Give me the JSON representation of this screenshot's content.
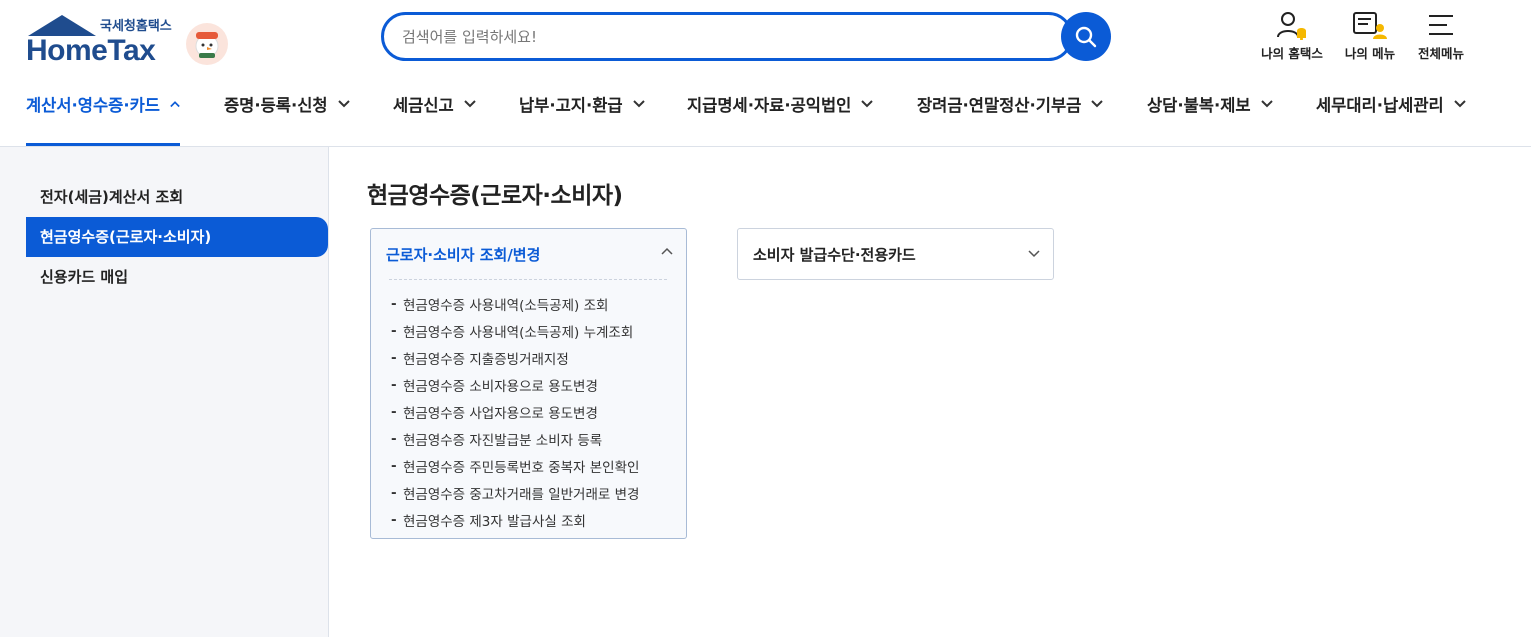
{
  "header": {
    "logo_main": "HomeTax",
    "logo_sub": "국세청홈택스",
    "search_placeholder": "검색어를 입력하세요!",
    "util": [
      {
        "label": "나의 홈택스",
        "icon": "user-bell-icon"
      },
      {
        "label": "나의 메뉴",
        "icon": "menu-user-icon"
      },
      {
        "label": "전체메뉴",
        "icon": "hamburger-icon"
      }
    ]
  },
  "gnb": [
    {
      "label": "계산서·영수증·카드",
      "active": true
    },
    {
      "label": "증명·등록·신청"
    },
    {
      "label": "세금신고"
    },
    {
      "label": "납부·고지·환급"
    },
    {
      "label": "지급명세·자료·공익법인"
    },
    {
      "label": "장려금·연말정산·기부금"
    },
    {
      "label": "상담·불복·제보"
    },
    {
      "label": "세무대리·납세관리"
    }
  ],
  "lnb": [
    {
      "label": "전자(세금)계산서 조회"
    },
    {
      "label": "현금영수증(근로자·소비자)",
      "active": true
    },
    {
      "label": "신용카드 매입"
    }
  ],
  "main": {
    "title": "현금영수증(근로자·소비자)",
    "card": {
      "heading": "근로자·소비자 조회/변경",
      "items": [
        "현금영수증 사용내역(소득공제) 조회",
        "현금영수증 사용내역(소득공제) 누계조회",
        "현금영수증 지출증빙거래지정",
        "현금영수증 소비자용으로 용도변경",
        "현금영수증 사업자용으로 용도변경",
        "현금영수증 자진발급분 소비자 등록",
        "현금영수증 주민등록번호 중복자 본인확인",
        "현금영수증 중고차거래를 일반거래로 변경",
        "현금영수증 제3자 발급사실 조회"
      ]
    },
    "dropdown": {
      "label": "소비자 발급수단·전용카드"
    }
  },
  "colors": {
    "accent": "#0b5bd6",
    "brand": "#1f4c8e"
  }
}
